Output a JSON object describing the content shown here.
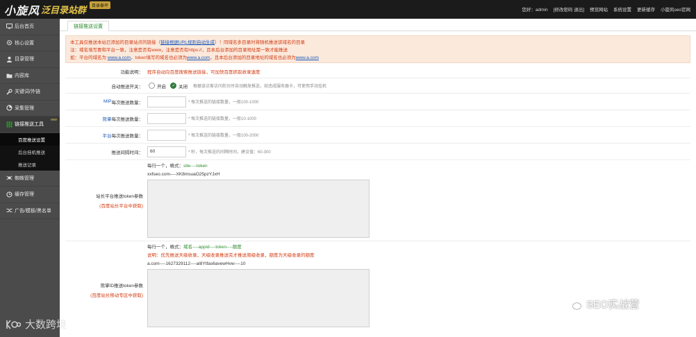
{
  "topbar": {
    "logo_main": "小旋风",
    "logo_sub": "泛目录站群",
    "logo_badge": "目录泰坪",
    "nav": [
      "您好：admin",
      "[修改密码 退出]",
      "预览网站",
      "系统设置",
      "更新缓存",
      "小旋风seo官网"
    ]
  },
  "sidebar": {
    "items": [
      {
        "label": "后台首页",
        "icon": "monitor-icon"
      },
      {
        "label": "核心设置",
        "icon": "gear-icon"
      },
      {
        "label": "目录管理",
        "icon": "user-icon"
      },
      {
        "label": "内容库",
        "icon": "folder-icon"
      },
      {
        "label": "关键词/外链",
        "icon": "wrench-icon"
      },
      {
        "label": "采集管理",
        "icon": "chart-icon"
      },
      {
        "label": "链接推送工具",
        "icon": "grid-icon",
        "badge": "new"
      }
    ],
    "sub_items": [
      "百度推送设置",
      "后台挂机推送",
      "推送记录"
    ],
    "items_after": [
      {
        "label": "蜘蛛管理",
        "icon": "spider-icon"
      },
      {
        "label": "缓存管理",
        "icon": "clock-icon"
      },
      {
        "label": "广告/模板/黑名单",
        "icon": "shuffle-icon"
      }
    ]
  },
  "tab": {
    "label": "链接推送设置"
  },
  "notice": {
    "line1_pre": "本工具仅推送本站已添加的目录站点的链接（",
    "line1_link": "链接根据URL规则自动生成",
    "line1_post": "）！同域名多目录时将随机推送该域名的目录",
    "line2": "注：域名填写要和平台一致，注意是否有www，注意是否有https://，且本后台添加的目录地址需一致才能推送",
    "line3_pre": "如：平台的域名为 ",
    "line3_link1": "www.a.com",
    "line3_mid": "，token填写的域名也必须为",
    "line3_link2": "www.a.com",
    "line3_mid2": "，且本后台添加的目录地址的域名也必须为",
    "line3_link3": "www.a.com"
  },
  "form": {
    "func_label": "功能说明：",
    "func_value": "程序自动向百度搜索推送链接，可加快百度抓取收录速度",
    "auto_label": "自动推送开关：",
    "auto_on": "开启",
    "auto_off": "关闭",
    "auto_hint": "根据该访客访问前台时自动触发推送，如违成服务器卡，可使用手动挂机",
    "mip_label_a": "MIP",
    "mip_label_b": "每次推送数量：",
    "mip_value": "",
    "mip_hint": "* 每次推送的链接数量，一般100-1000",
    "xz_label_a": "熊掌",
    "xz_label_b": "每次推送数量：",
    "xz_value": "",
    "xz_hint": "* 每次推送的链接数量，一般10-1000",
    "pt_label_a": "平台",
    "pt_label_b": "每次推送数量：",
    "pt_value": "",
    "pt_hint": "* 每次推送的链接数量，一般100-2000",
    "interval_label": "推送间隔时间：",
    "interval_value": "60",
    "interval_hint": "* 秒，每次推送的间隔时间，建议值：60-300",
    "token_label": "站长平台推送token参数",
    "token_sub": "(百度站长平台中获取)",
    "token_format_pre": "每行一个，格式：",
    "token_format": "site----token",
    "token_value": "xxfseo.com----XK8msuaO25pzYJxH",
    "xzid_label": "熊掌ID推送token参数",
    "xzid_sub": "(百度站长移动专区中获取)",
    "xzid_format_pre": "每行一个，格式：",
    "xzid_format": "域名----appid----token----额度",
    "xzid_note": "说明：优先推送天级收录，天级收录推送完才推送周级收录，额度为天级收录的额度",
    "xzid_value": "a.com----1627329112----al8Ytfas6avewHvw----10"
  },
  "watermarks": {
    "left": "大数跨境",
    "right": "SEO实战营"
  }
}
